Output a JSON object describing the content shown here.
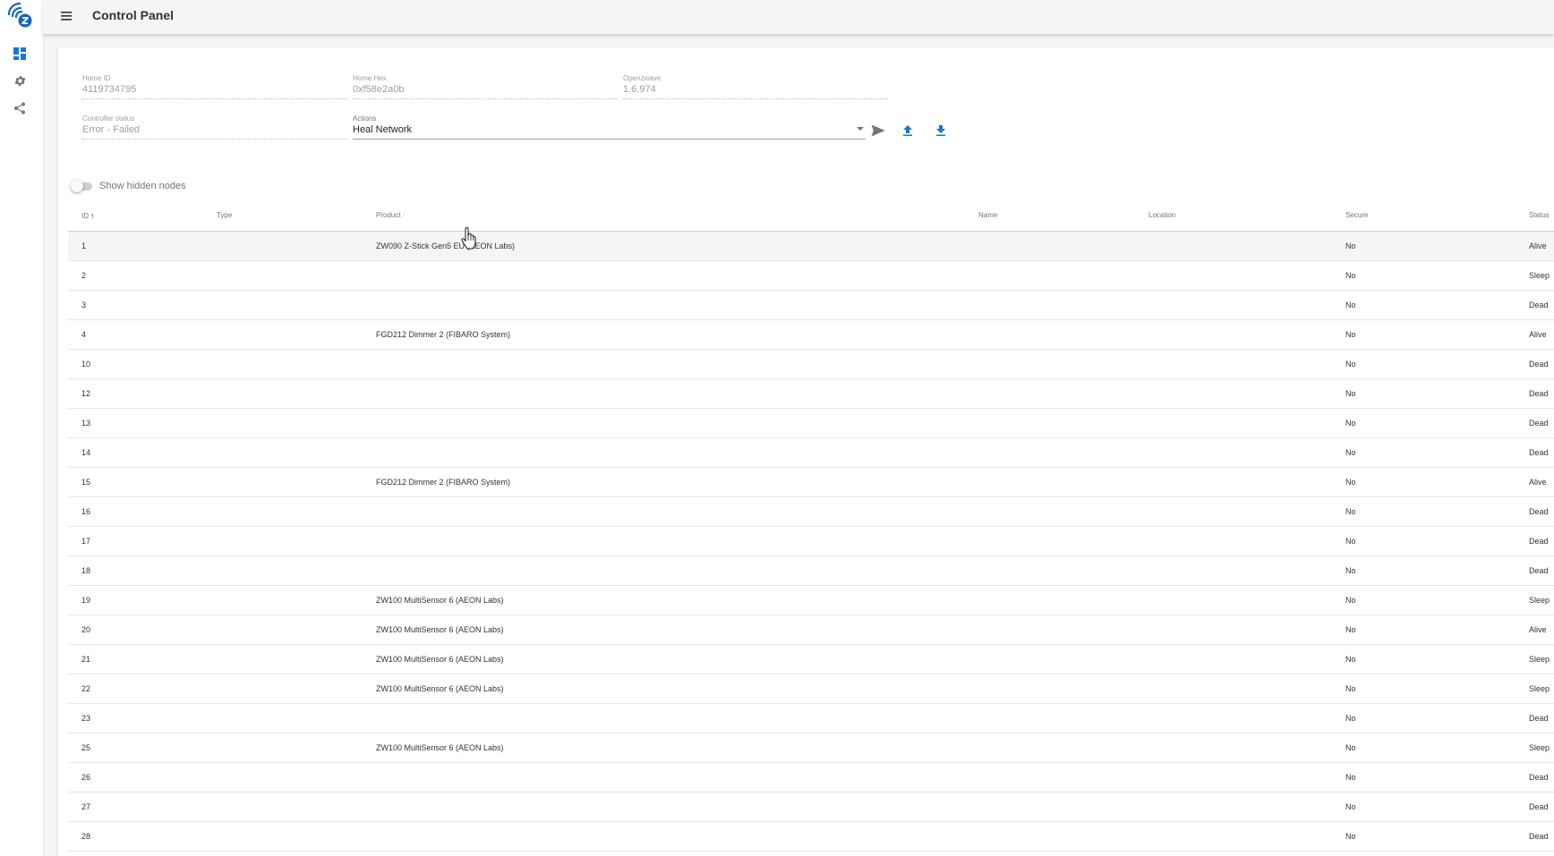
{
  "app": {
    "title": "Control Panel",
    "nav": [
      {
        "name": "control-panel-icon",
        "active": true
      },
      {
        "name": "settings-icon",
        "active": false
      },
      {
        "name": "share-icon",
        "active": false
      }
    ],
    "accent": "#1976d2"
  },
  "info_fields": {
    "home_id": {
      "label": "Home ID",
      "value": "4119734795"
    },
    "home_hex": {
      "label": "Home Hex",
      "value": "0xf58e2a0b"
    },
    "openzwave": {
      "label": "Openzwave",
      "value": "1.6.974"
    },
    "controller_status": {
      "label": "Controller status",
      "value": "Error - Failed"
    },
    "actions": {
      "label": "Actions",
      "value": "Heal Network"
    }
  },
  "toggle": {
    "label": "Show hidden nodes",
    "on": false
  },
  "table": {
    "headers": {
      "id": "ID",
      "type": "Type",
      "product": "Product",
      "name": "Name",
      "location": "Location",
      "secure": "Secure",
      "status": "Status"
    },
    "rows": [
      {
        "id": "1",
        "type": "",
        "product": "ZW090 Z-Stick Gen5 EU (AEON Labs)",
        "name": "",
        "location": "",
        "secure": "No",
        "status": "Alive"
      },
      {
        "id": "2",
        "type": "",
        "product": "",
        "name": "",
        "location": "",
        "secure": "No",
        "status": "Sleep"
      },
      {
        "id": "3",
        "type": "",
        "product": "",
        "name": "",
        "location": "",
        "secure": "No",
        "status": "Dead"
      },
      {
        "id": "4",
        "type": "",
        "product": "FGD212 Dimmer 2 (FIBARO System)",
        "name": "",
        "location": "",
        "secure": "No",
        "status": "Alive"
      },
      {
        "id": "10",
        "type": "",
        "product": "",
        "name": "",
        "location": "",
        "secure": "No",
        "status": "Dead"
      },
      {
        "id": "12",
        "type": "",
        "product": "",
        "name": "",
        "location": "",
        "secure": "No",
        "status": "Dead"
      },
      {
        "id": "13",
        "type": "",
        "product": "",
        "name": "",
        "location": "",
        "secure": "No",
        "status": "Dead"
      },
      {
        "id": "14",
        "type": "",
        "product": "",
        "name": "",
        "location": "",
        "secure": "No",
        "status": "Dead"
      },
      {
        "id": "15",
        "type": "",
        "product": "FGD212 Dimmer 2 (FIBARO System)",
        "name": "",
        "location": "",
        "secure": "No",
        "status": "Alive"
      },
      {
        "id": "16",
        "type": "",
        "product": "",
        "name": "",
        "location": "",
        "secure": "No",
        "status": "Dead"
      },
      {
        "id": "17",
        "type": "",
        "product": "",
        "name": "",
        "location": "",
        "secure": "No",
        "status": "Dead"
      },
      {
        "id": "18",
        "type": "",
        "product": "",
        "name": "",
        "location": "",
        "secure": "No",
        "status": "Dead"
      },
      {
        "id": "19",
        "type": "",
        "product": "ZW100 MultiSensor 6 (AEON Labs)",
        "name": "",
        "location": "",
        "secure": "No",
        "status": "Sleep"
      },
      {
        "id": "20",
        "type": "",
        "product": "ZW100 MultiSensor 6 (AEON Labs)",
        "name": "",
        "location": "",
        "secure": "No",
        "status": "Alive"
      },
      {
        "id": "21",
        "type": "",
        "product": "ZW100 MultiSensor 6 (AEON Labs)",
        "name": "",
        "location": "",
        "secure": "No",
        "status": "Sleep"
      },
      {
        "id": "22",
        "type": "",
        "product": "ZW100 MultiSensor 6 (AEON Labs)",
        "name": "",
        "location": "",
        "secure": "No",
        "status": "Sleep"
      },
      {
        "id": "23",
        "type": "",
        "product": "",
        "name": "",
        "location": "",
        "secure": "No",
        "status": "Dead"
      },
      {
        "id": "25",
        "type": "",
        "product": "ZW100 MultiSensor 6 (AEON Labs)",
        "name": "",
        "location": "",
        "secure": "No",
        "status": "Sleep"
      },
      {
        "id": "26",
        "type": "",
        "product": "",
        "name": "",
        "location": "",
        "secure": "No",
        "status": "Dead"
      },
      {
        "id": "27",
        "type": "",
        "product": "",
        "name": "",
        "location": "",
        "secure": "No",
        "status": "Dead"
      },
      {
        "id": "28",
        "type": "",
        "product": "",
        "name": "",
        "location": "",
        "secure": "No",
        "status": "Dead"
      }
    ]
  }
}
